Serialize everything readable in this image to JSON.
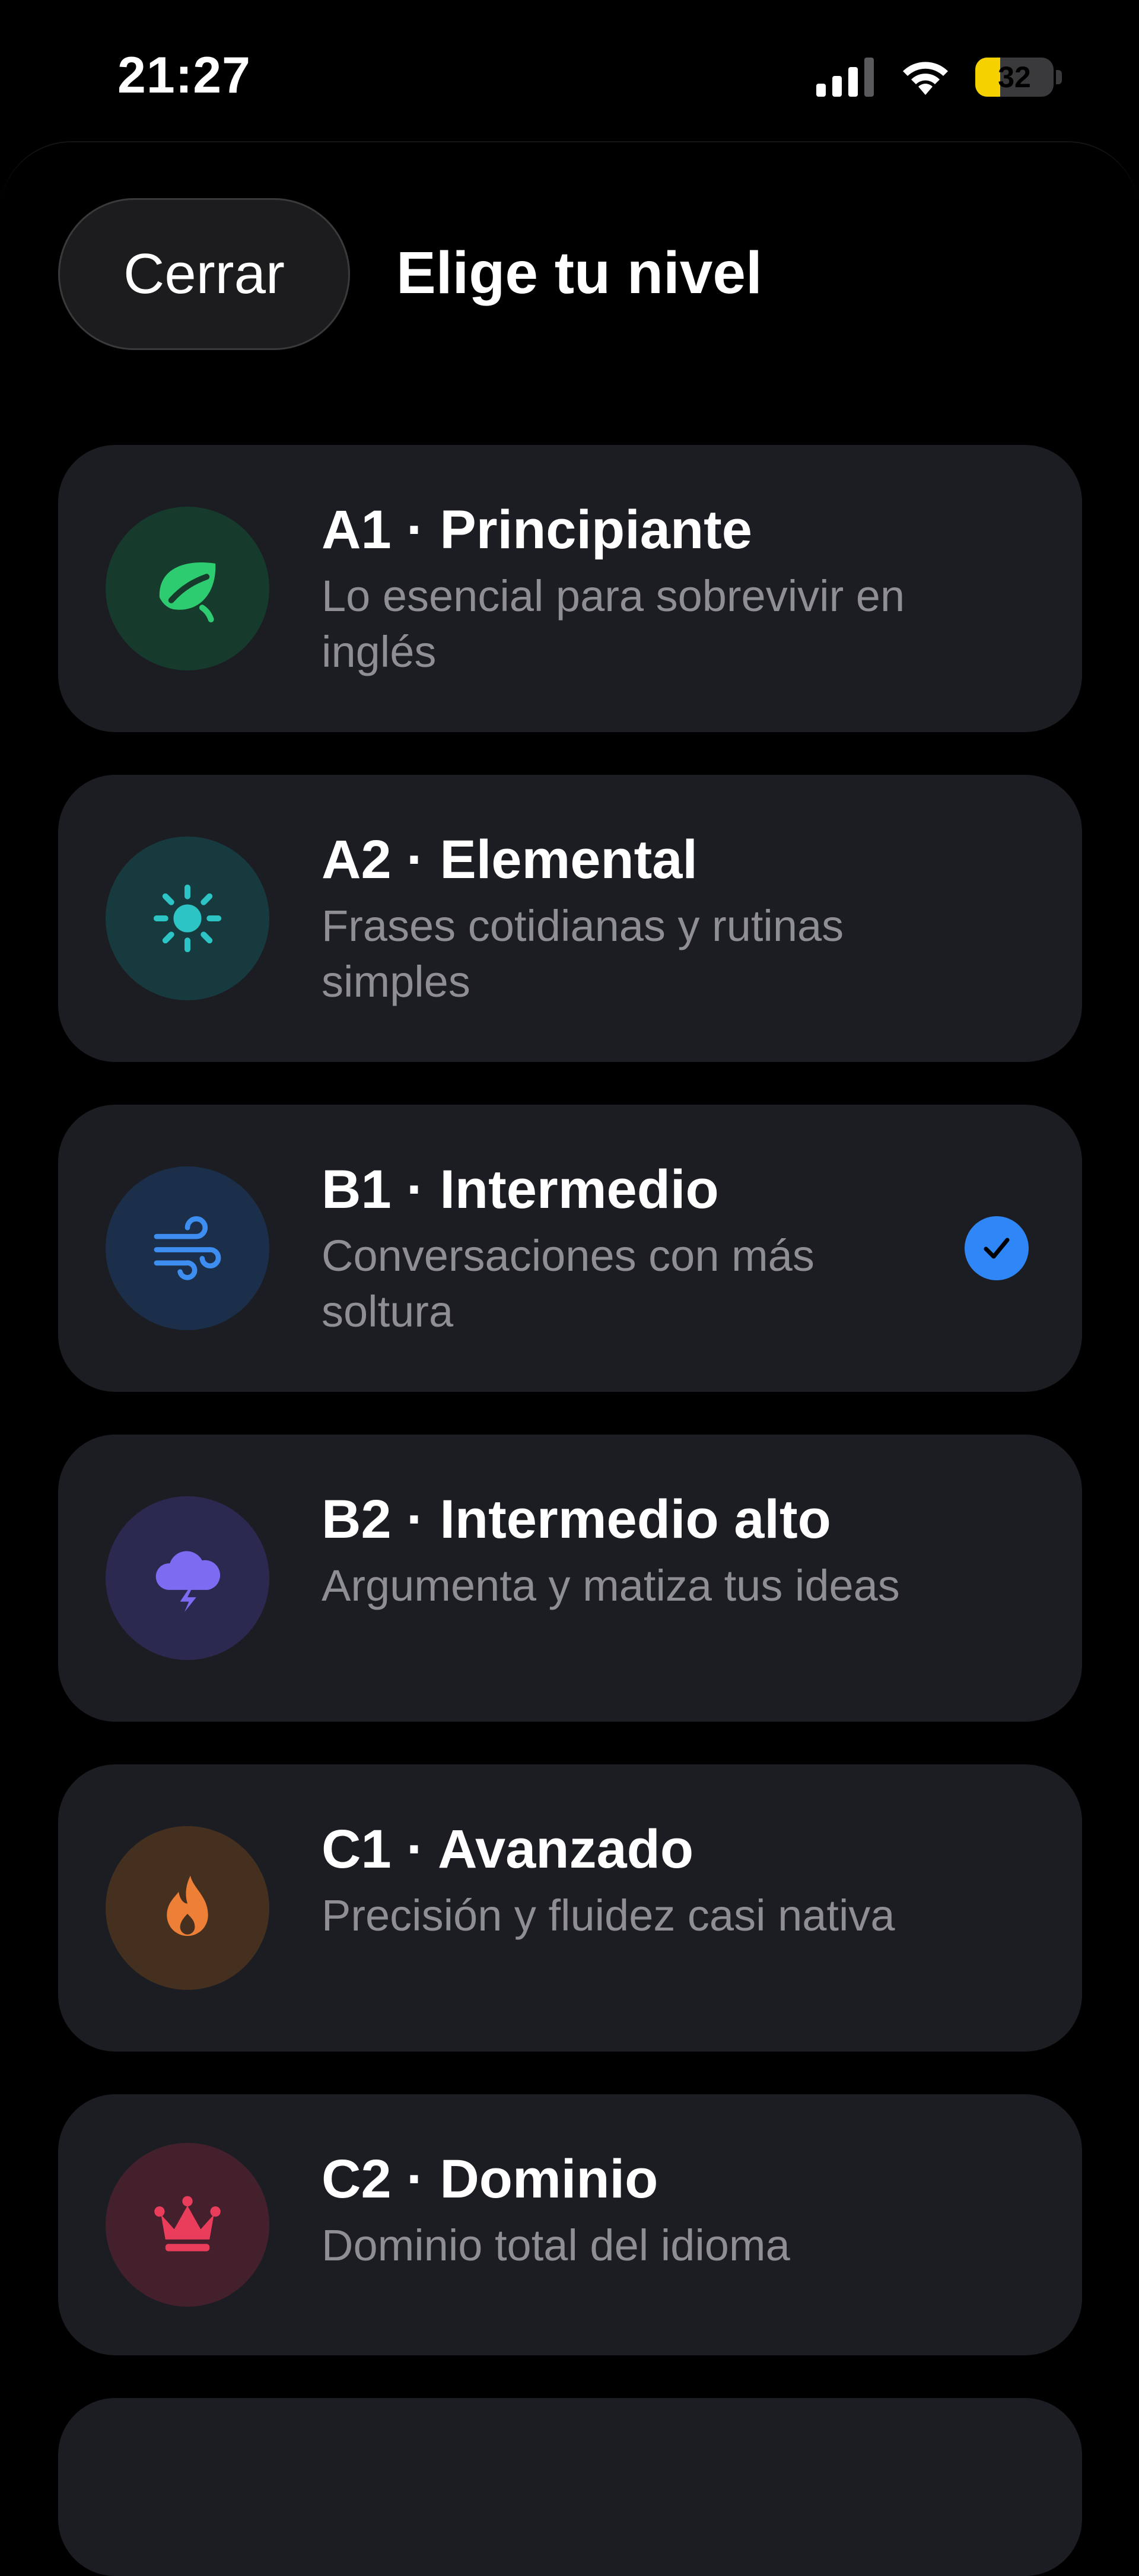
{
  "status_bar": {
    "time": "21:27",
    "battery_level": "32",
    "battery_fraction": 0.32,
    "signal_icon": "cellular-signal-icon",
    "wifi_icon": "wifi-icon"
  },
  "header": {
    "close_label": "Cerrar",
    "title": "Elige tu nivel"
  },
  "levels": [
    {
      "title": "A1 · Principiante",
      "description": "Lo esencial para sobrevivir en inglés",
      "icon": "leaf-icon",
      "icon_color": "#2ecc71",
      "icon_bg": "#163a2b",
      "selected": false
    },
    {
      "title": "A2 · Elemental",
      "description": "Frases cotidianas y rutinas simples",
      "icon": "sun-icon",
      "icon_color": "#2cc4c4",
      "icon_bg": "#173a3e",
      "selected": false
    },
    {
      "title": "B1 · Intermedio",
      "description": "Conversaciones con más soltura",
      "icon": "wind-icon",
      "icon_color": "#3d8ef0",
      "icon_bg": "#1b2f4a",
      "selected": true
    },
    {
      "title": "B2 · Intermedio alto",
      "description": "Argumenta y matiza tus ideas",
      "icon": "storm-cloud-icon",
      "icon_color": "#7d6cf2",
      "icon_bg": "#2b2950",
      "selected": false
    },
    {
      "title": "C1 · Avanzado",
      "description": "Precisión y fluidez casi nativa",
      "icon": "flame-icon",
      "icon_color": "#ee7f36",
      "icon_bg": "#45301f",
      "selected": false
    },
    {
      "title": "C2 · Dominio",
      "description": "Dominio total del idioma",
      "icon": "crown-icon",
      "icon_color": "#ea3d5c",
      "icon_bg": "#44202c",
      "selected": false
    }
  ],
  "colors": {
    "accent": "#2f86f6",
    "card_bg": "#1c1d22",
    "secondary_text": "#8e8e93"
  }
}
